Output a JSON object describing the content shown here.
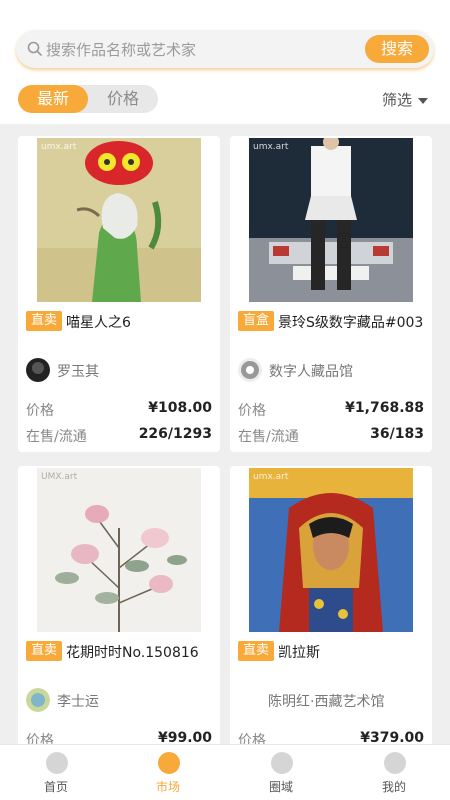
{
  "search": {
    "placeholder": "搜索作品名称或艺术家",
    "button": "搜索"
  },
  "tabs": [
    {
      "label": "最新",
      "active": true
    },
    {
      "label": "价格",
      "active": false
    }
  ],
  "filter": {
    "label": "筛选"
  },
  "accent_color": "#f7a93a",
  "cards": [
    {
      "badge": "直卖",
      "title": "喵星人之6",
      "author": "罗玉其",
      "price_label": "价格",
      "price": "¥108.00",
      "stock_label": "在售/流通",
      "stock": "226/1293",
      "watermark": "umx.art"
    },
    {
      "badge": "盲盒",
      "title": "景玲S级数字藏品#003",
      "author": "数字人藏品馆",
      "price_label": "价格",
      "price": "¥1,768.88",
      "stock_label": "在售/流通",
      "stock": "36/183",
      "watermark": "umx.art"
    },
    {
      "badge": "直卖",
      "title": "花期时时No.150816",
      "author": "李士运",
      "price_label": "价格",
      "price": "¥99.00",
      "watermark": "UMX.art"
    },
    {
      "badge": "直卖",
      "title": "凯拉斯",
      "author": "陈明红·西藏艺术馆",
      "price_label": "价格",
      "price": "¥379.00",
      "watermark": "umx.art"
    }
  ],
  "bottom_nav": [
    {
      "label": "首页",
      "icon": "home-icon",
      "active": false
    },
    {
      "label": "市场",
      "icon": "market-icon",
      "active": true
    },
    {
      "label": "圈域",
      "icon": "circle-icon",
      "active": false
    },
    {
      "label": "我的",
      "icon": "profile-icon",
      "active": false
    }
  ]
}
